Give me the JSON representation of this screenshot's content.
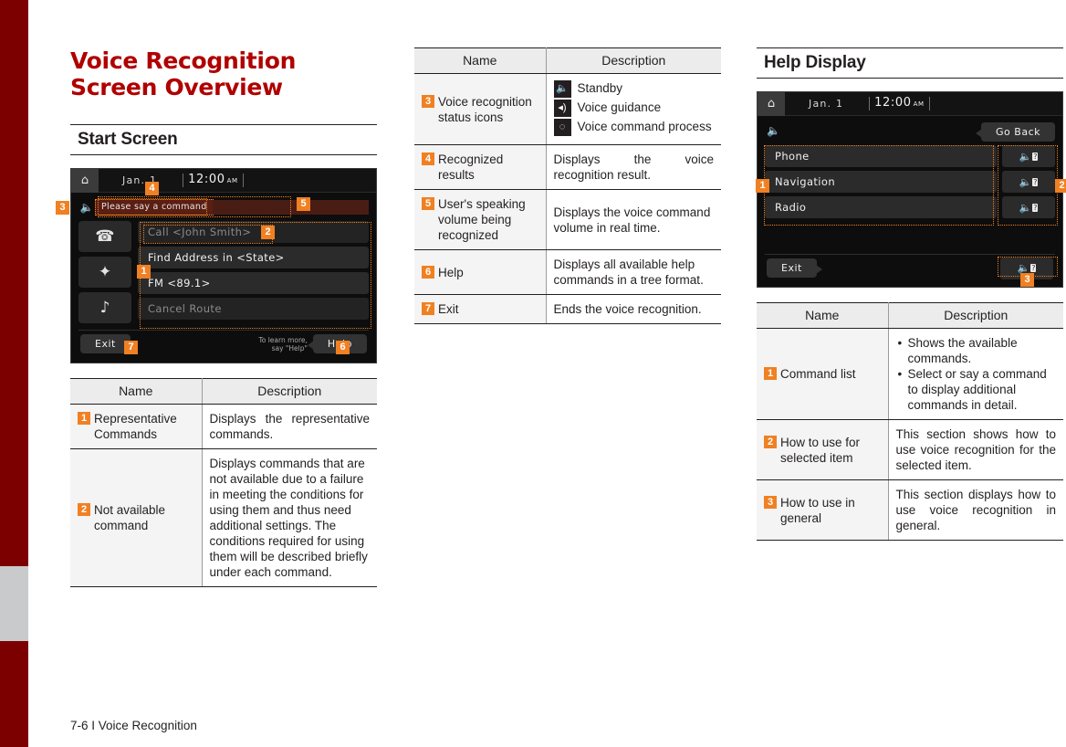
{
  "chapter": {
    "title_line1": "Voice Recognition",
    "title_line2": "Screen Overview"
  },
  "sections": {
    "start_screen": "Start Screen",
    "help_display": "Help Display"
  },
  "start_device": {
    "home_icon": "home-icon",
    "date": "Jan.  1",
    "time": "12:00",
    "ampm": "AM",
    "speaker_icon": "speaker-icon",
    "recognized_text": "Please say a command",
    "side_icons": [
      "phone-icon",
      "navigation-icon",
      "music-note-icon"
    ],
    "commands": [
      {
        "label": "Call <John Smith>",
        "available": false
      },
      {
        "label": "Find Address in <State>",
        "available": true
      },
      {
        "label": "FM <89.1>",
        "available": true
      },
      {
        "label": "Cancel Route",
        "available": false
      }
    ],
    "exit_label": "Exit",
    "hint_line1": "To learn more,",
    "hint_line2": "say \"Help\"",
    "help_label": "Help",
    "badges": [
      "1",
      "2",
      "3",
      "4",
      "5",
      "6",
      "7"
    ]
  },
  "help_device": {
    "home_icon": "home-icon",
    "date": "Jan.  1",
    "time": "12:00",
    "ampm": "AM",
    "speaker_icon": "speaker-icon",
    "go_back_label": "Go Back",
    "commands": [
      "Phone",
      "Navigation",
      "Radio"
    ],
    "mic_help_icon": "mic-help-icon",
    "exit_label": "Exit",
    "badges": [
      "1",
      "2",
      "3"
    ]
  },
  "table_headers": {
    "name": "Name",
    "description": "Description"
  },
  "start_table": [
    {
      "num": "1",
      "name": "Representative Commands",
      "desc": "Displays the representative commands."
    },
    {
      "num": "2",
      "name": "Not available command",
      "desc": "Displays commands that are not available due to a failure in meeting the conditions for using them and thus need additional settings. The conditions required for using them will be described briefly under each command."
    }
  ],
  "status_table": [
    {
      "num": "3",
      "name": "Voice recognition status icons",
      "icons": [
        {
          "icon": "microphone-icon",
          "label": "Standby"
        },
        {
          "icon": "speaker-icon",
          "label": "Voice guidance"
        },
        {
          "icon": "spinner-icon",
          "label": "Voice command process"
        }
      ]
    },
    {
      "num": "4",
      "name": "Recognized results",
      "desc": "Displays the voice recognition result."
    },
    {
      "num": "5",
      "name": "User's speaking volume being recognized",
      "desc": "Displays the voice command volume in real time."
    },
    {
      "num": "6",
      "name": "Help",
      "desc": "Displays all available help commands in a tree format."
    },
    {
      "num": "7",
      "name": "Exit",
      "desc": "Ends the voice recognition."
    }
  ],
  "help_table": [
    {
      "num": "1",
      "name": "Command list",
      "bullets": [
        "Shows the available commands.",
        "Select or say a command to display additional commands in detail."
      ]
    },
    {
      "num": "2",
      "name": "How to use for selected item",
      "desc": "This section shows how to use voice recognition for the selected item."
    },
    {
      "num": "3",
      "name": "How to use in general",
      "desc": "This section displays how to use voice recognition in general."
    }
  ],
  "footer": {
    "text": "7-6 I Voice Recognition"
  },
  "colors": {
    "accent": "#f08022",
    "title_red": "#b00000",
    "edge_red": "#7d0000"
  }
}
